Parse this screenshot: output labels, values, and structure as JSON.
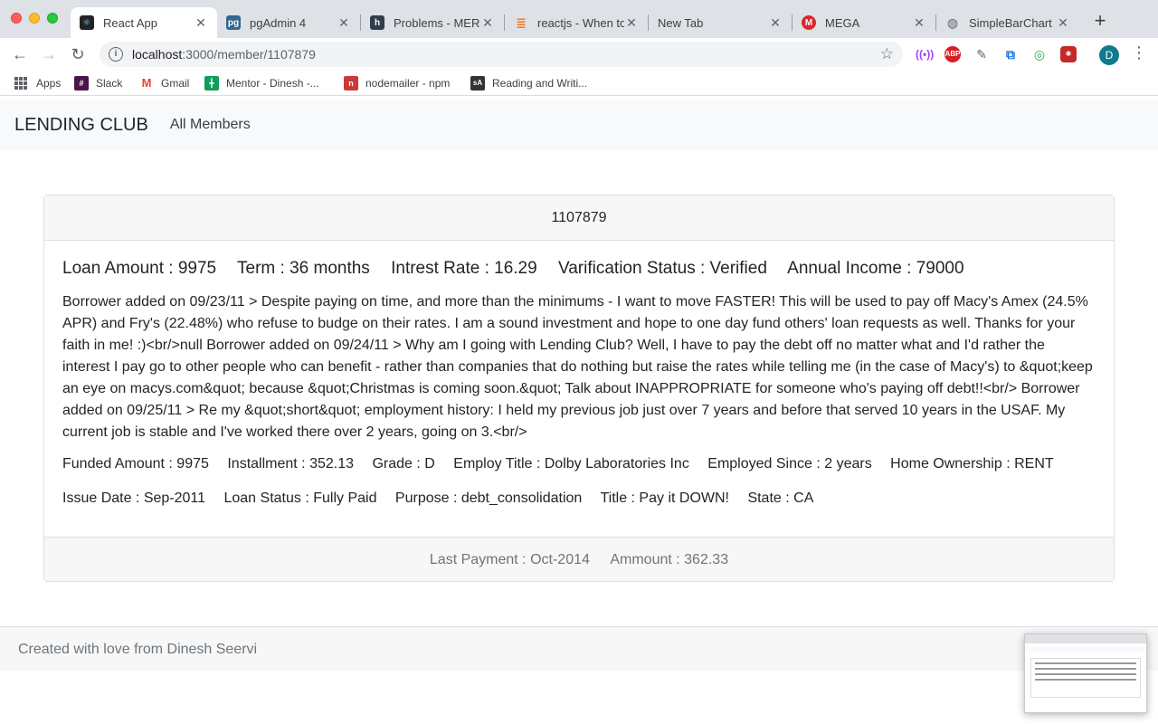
{
  "browser": {
    "tabs": [
      {
        "title": "React App",
        "favicon": "react-icon",
        "active": true
      },
      {
        "title": "pgAdmin 4",
        "favicon": "pgadmin-icon"
      },
      {
        "title": "Problems - MERN",
        "favicon": "hackerrank-icon"
      },
      {
        "title": "reactjs - When to",
        "favicon": "stackoverflow-icon"
      },
      {
        "title": "New Tab",
        "favicon": ""
      },
      {
        "title": "MEGA",
        "favicon": "mega-icon"
      },
      {
        "title": "SimpleBarChart",
        "favicon": "globe-icon"
      }
    ],
    "url_host": "localhost",
    "url_path": ":3000/member/1107879",
    "profile_initial": "D",
    "bookmarks": [
      {
        "label": "Apps",
        "icon": "apps-grid-icon"
      },
      {
        "label": "Slack",
        "icon": "slack-icon"
      },
      {
        "label": "Gmail",
        "icon": "gmail-icon"
      },
      {
        "label": "Mentor - Dinesh -...",
        "icon": "sheets-icon"
      },
      {
        "label": "nodemailer - npm",
        "icon": "npm-icon"
      },
      {
        "label": "Reading and Writi...",
        "icon": "sa-icon"
      }
    ],
    "extensions": {
      "abp": "ABP"
    }
  },
  "navbar": {
    "brand": "LENDING CLUB",
    "link_all_members": "All Members"
  },
  "member": {
    "id": "1107879",
    "summary": {
      "loan_amount": "Loan Amount : 9975",
      "term": "Term : 36 months",
      "interest_rate": "Intrest Rate : 16.29",
      "verification_status": "Varification Status : Verified",
      "annual_income": "Annual Income : 79000"
    },
    "description": "Borrower added on 09/23/11 > Despite paying on time, and more than the minimums - I want to move FASTER! This will be used to pay off Macy's Amex (24.5% APR) and Fry's (22.48%) who refuse to budge on their rates. I am a sound investment and hope to one day fund others' loan requests as well. Thanks for your faith in me! :)<br/>null Borrower added on 09/24/11 > Why am I going with Lending Club? Well, I have to pay the debt off no matter what and I'd rather the interest I pay go to other people who can benefit - rather than companies that do nothing but raise the rates while telling me (in the case of Macy's) to &quot;keep an eye on macys.com&quot; because &quot;Christmas is coming soon.&quot; Talk about INAPPROPRIATE for someone who's paying off debt!!<br/> Borrower added on 09/25/11 > Re my &quot;short&quot; employment history: I held my previous job just over 7 years and before that served 10 years in the USAF. My current job is stable and I've worked there over 2 years, going on 3.<br/>",
    "details_row1": {
      "funded_amount": "Funded Amount : 9975",
      "installment": "Installment : 352.13",
      "grade": "Grade : D",
      "employ_title": "Employ Title : Dolby Laboratories Inc",
      "employed_since": "Employed Since : 2 years",
      "home_ownership": "Home Ownership : RENT"
    },
    "details_row2": {
      "issue_date": "Issue Date : Sep-2011",
      "loan_status": "Loan Status : Fully Paid",
      "purpose": "Purpose : debt_consolidation",
      "title": "Title : Pay it DOWN!",
      "state": "State : CA"
    },
    "footer": {
      "last_payment": "Last Payment : Oct-2014",
      "amount": "Ammount : 362.33"
    }
  },
  "page_footer": {
    "text": "Created with love from Dinesh Seervi"
  }
}
